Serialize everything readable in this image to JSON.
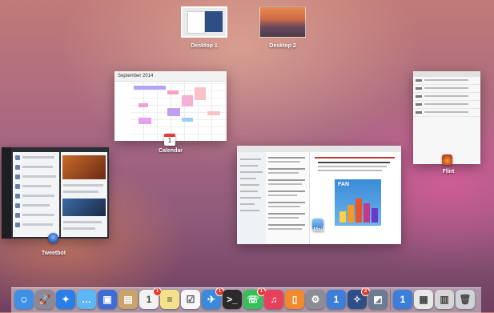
{
  "desktops": [
    {
      "label": "Desktop 1"
    },
    {
      "label": "Desktop 2"
    }
  ],
  "windows": {
    "calendar": {
      "label": "Calendar",
      "month": "September 2014",
      "icon_day": "1"
    },
    "tweetbot": {
      "label": "Tweetbot"
    },
    "mail": {
      "label": "Mail",
      "fan_title": "FAN"
    },
    "flint": {
      "label": "Flint"
    }
  },
  "dock": {
    "items": [
      {
        "name": "finder",
        "glyph": "☺",
        "color": "#3f8fe6"
      },
      {
        "name": "launchpad",
        "glyph": "🚀",
        "color": "#8a8a96"
      },
      {
        "name": "safari",
        "glyph": "✦",
        "color": "#2a7ee8"
      },
      {
        "name": "messages",
        "glyph": "…",
        "color": "#5db6f5"
      },
      {
        "name": "photo",
        "glyph": "▣",
        "color": "#3f6bd6"
      },
      {
        "name": "contacts",
        "glyph": "▤",
        "color": "#c9a36b"
      },
      {
        "name": "calendar",
        "glyph": "1",
        "color": "#f2f2f2",
        "badge": "1"
      },
      {
        "name": "notes",
        "glyph": "≡",
        "color": "#f4e28a"
      },
      {
        "name": "reminders",
        "glyph": "☑",
        "color": "#f7f7f7"
      },
      {
        "name": "tweetbot",
        "glyph": "✈",
        "color": "#3a8bdc",
        "badge": "1"
      },
      {
        "name": "terminal",
        "glyph": ">_",
        "color": "#2a2a2a"
      },
      {
        "name": "facetime",
        "glyph": "☏",
        "color": "#36c05a",
        "badge": "1"
      },
      {
        "name": "itunes",
        "glyph": "♫",
        "color": "#e8405c"
      },
      {
        "name": "ibooks",
        "glyph": "▯",
        "color": "#f08a2a"
      },
      {
        "name": "system-preferences",
        "glyph": "⚙",
        "color": "#8a8d96"
      },
      {
        "name": "1password",
        "glyph": "1",
        "color": "#3d7fd8"
      },
      {
        "name": "rocket",
        "glyph": "✧",
        "color": "#2d4f86",
        "badge": "2"
      },
      {
        "name": "preview",
        "glyph": "◩",
        "color": "#6c7a92"
      },
      {
        "name": "1password-mini",
        "glyph": "1",
        "color": "#3d7fd8"
      },
      {
        "name": "documents",
        "glyph": "▦",
        "color": "#e8e8e8"
      },
      {
        "name": "downloads",
        "glyph": "▥",
        "color": "#d6d6d6"
      },
      {
        "name": "trash",
        "glyph": "🗑",
        "color": "#cfd3d8"
      }
    ]
  }
}
